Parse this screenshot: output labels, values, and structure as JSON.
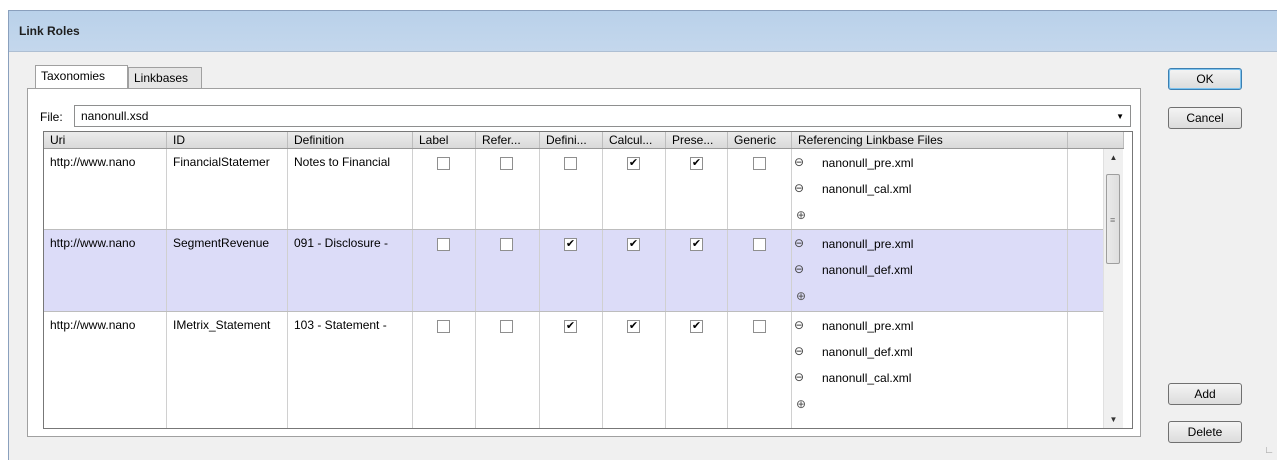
{
  "window": {
    "title": "Link Roles"
  },
  "tabs": [
    {
      "label": "Taxonomies",
      "active": true
    },
    {
      "label": "Linkbases",
      "active": false
    }
  ],
  "file": {
    "label": "File:",
    "value": "nanonull.xsd"
  },
  "grid": {
    "columns": [
      "Uri",
      "ID",
      "Definition",
      "Label",
      "Refer...",
      "Defini...",
      "Calcul...",
      "Prese...",
      "Generic",
      "Referencing Linkbase Files"
    ],
    "rows": [
      {
        "uri": "http://www.nano",
        "id": "FinancialStatemer",
        "definition": "Notes to Financial",
        "label": false,
        "reference": false,
        "definition_check": false,
        "calculation": true,
        "presentation": true,
        "generic": false,
        "selected": false,
        "files": [
          "nanonull_pre.xml",
          "nanonull_cal.xml"
        ]
      },
      {
        "uri": "http://www.nano",
        "id": "SegmentRevenue",
        "definition": "091 - Disclosure -",
        "label": false,
        "reference": false,
        "definition_check": true,
        "calculation": true,
        "presentation": true,
        "generic": false,
        "selected": true,
        "files": [
          "nanonull_pre.xml",
          "nanonull_def.xml"
        ]
      },
      {
        "uri": "http://www.nano",
        "id": "IMetrix_Statement",
        "definition": "103 - Statement -",
        "label": false,
        "reference": false,
        "definition_check": true,
        "calculation": true,
        "presentation": true,
        "generic": false,
        "selected": false,
        "files": [
          "nanonull_pre.xml",
          "nanonull_def.xml",
          "nanonull_cal.xml"
        ]
      }
    ]
  },
  "buttons": {
    "ok": "OK",
    "cancel": "Cancel",
    "add": "Add",
    "delete": "Delete"
  },
  "icons": {
    "remove": "minus-circle-icon",
    "add": "plus-circle-icon"
  },
  "colors": {
    "title_bar": "#b9d1ea",
    "selected_row": "#dcdcf8"
  }
}
